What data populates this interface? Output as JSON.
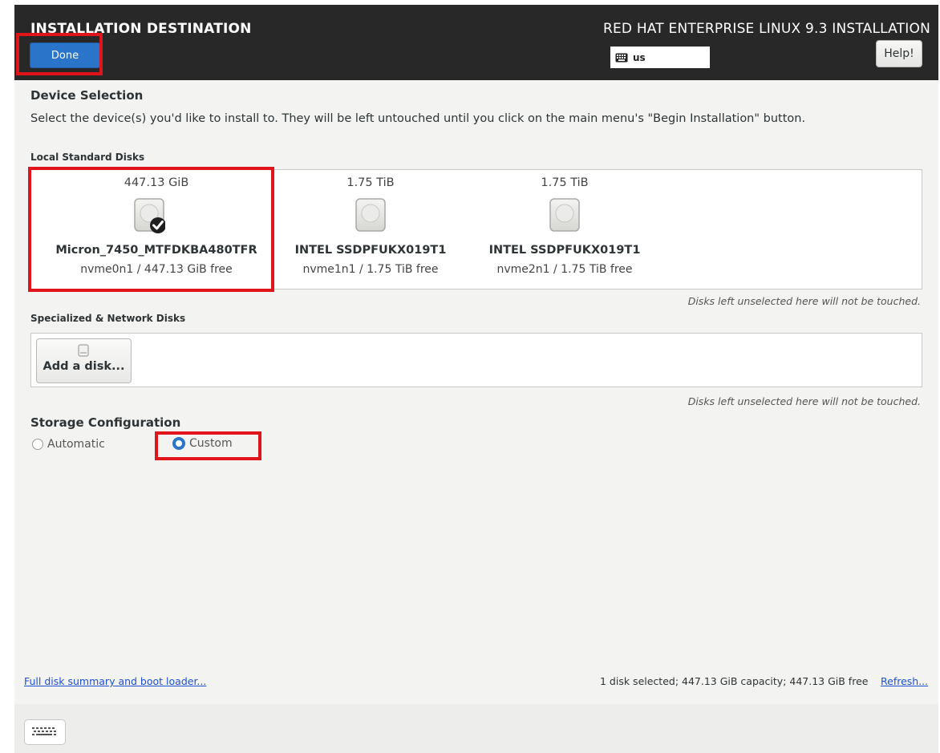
{
  "header": {
    "title": "INSTALLATION DESTINATION",
    "product": "RED HAT ENTERPRISE LINUX 9.3 INSTALLATION",
    "done_label": "Done",
    "keyboard_layout": "us",
    "help_label": "Help!"
  },
  "device_selection": {
    "heading": "Device Selection",
    "description": "Select the device(s) you'd like to install to.  They will be left untouched until you click on the main menu's \"Begin Installation\" button."
  },
  "local_disks": {
    "heading": "Local Standard Disks",
    "note": "Disks left unselected here will not be touched.",
    "disks": [
      {
        "size": "447.13 GiB",
        "name": "Micron_7450_MTFDKBA480TFR",
        "info": "nvme0n1   /   447.13 GiB free",
        "selected": true
      },
      {
        "size": "1.75 TiB",
        "name": "INTEL SSDPFUKX019T1",
        "info": "nvme1n1  /  1.75 TiB free",
        "selected": false
      },
      {
        "size": "1.75 TiB",
        "name": "INTEL SSDPFUKX019T1",
        "info": "nvme2n1  /  1.75 TiB free",
        "selected": false
      }
    ]
  },
  "network_disks": {
    "heading": "Specialized & Network Disks",
    "add_label": "Add a disk...",
    "note": "Disks left unselected here will not be touched."
  },
  "storage_config": {
    "heading": "Storage Configuration",
    "options": [
      {
        "label": "Automatic",
        "selected": false
      },
      {
        "label": "Custom",
        "selected": true
      }
    ]
  },
  "footer": {
    "summary_link": "Full disk summary and boot loader...",
    "status": "1 disk selected; 447.13 GiB capacity; 447.13 GiB free",
    "refresh_link": "Refresh..."
  },
  "colors": {
    "accent": "#2a74c9",
    "header_bg": "#282828",
    "highlight": "#e0141b"
  }
}
